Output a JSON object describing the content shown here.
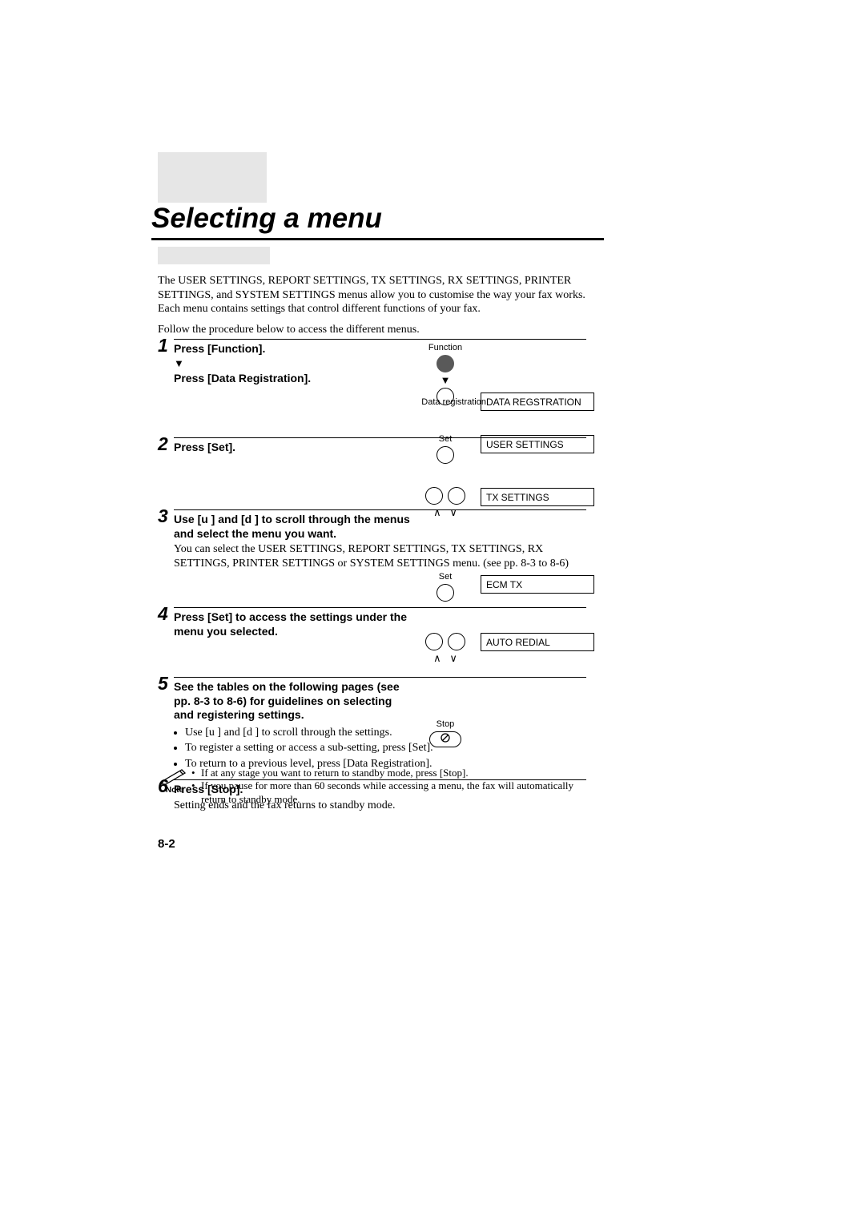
{
  "title": "Selecting a menu",
  "intro": {
    "p1": "The USER SETTINGS, REPORT SETTINGS, TX SETTINGS, RX SETTINGS, PRINTER SETTINGS, and SYSTEM SETTINGS menus allow you to customise the way your fax works. Each menu contains settings that control different functions of your fax.",
    "p2": "Follow the procedure below to access the different menus."
  },
  "steps": [
    {
      "n": "1",
      "title": "Press [Function].",
      "title2": "Press [Data Registration].",
      "btn1_label": "Function",
      "btn2_label": "Data registration",
      "display": "DATA REGSTRATION"
    },
    {
      "n": "2",
      "title": "Press [Set].",
      "btn_label": "Set",
      "display": "USER SETTINGS"
    },
    {
      "n": "3",
      "title": "Use [u ] and [d ] to scroll through the menus and select the menu you want.",
      "text": "You can select the USER SETTINGS, REPORT SETTINGS, TX SETTINGS, RX SETTINGS, PRINTER SETTINGS or SYSTEM SETTINGS menu. (see pp. 8-3 to 8-6)",
      "display": "TX SETTINGS"
    },
    {
      "n": "4",
      "title": "Press [Set] to access the settings under the menu you selected.",
      "btn_label": "Set",
      "display": "ECM TX"
    },
    {
      "n": "5",
      "title": "See the tables on the following pages (see pp. 8-3 to 8-6) for guidelines on selecting and registering settings.",
      "bullets": [
        "Use [u ] and [d ] to scroll through the settings.",
        "To register a setting or access a sub-setting, press [Set].",
        "To return to a previous level, press [Data Registration]."
      ],
      "display": "AUTO REDIAL"
    },
    {
      "n": "6",
      "title": "Press [Stop].",
      "text": "Setting ends and the fax returns to standby mode.",
      "btn_label": "Stop"
    }
  ],
  "note": {
    "label": "Note",
    "items": [
      "If at any stage you want to return to standby mode, press [Stop].",
      "If you pause for more than 60 seconds while accessing a menu, the fax will automatically return to standby mode."
    ]
  },
  "page_number": "8-2"
}
